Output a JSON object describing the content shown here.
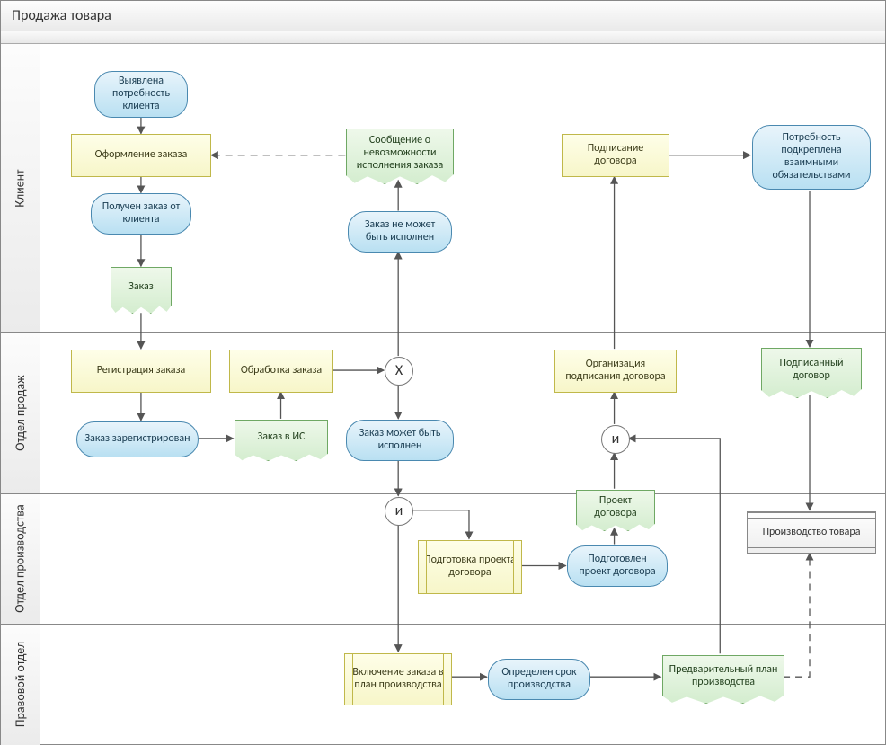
{
  "title": "Продажа товара",
  "lanes": {
    "l1": "Клиент",
    "l2": "Отдел продаж",
    "l3": "Отдел производства",
    "l4": "Правовой отдел"
  },
  "nodes": {
    "event_need": "Выявлена потребность клиента",
    "act_order": "Оформление заказа",
    "event_got_order": "Получен заказ от клиента",
    "doc_order": "Заказ",
    "doc_msg_impossible": "Сообщение о невозможности исполнения заказа",
    "event_cant_exec": "Заказ не может быть исполнен",
    "act_sign_contract": "Подписание договора",
    "event_need_confirmed": "Потребность подкреплена взаимными обязательствами",
    "act_register": "Регистрация заказа",
    "act_process": "Обработка заказа",
    "gw_x": "X",
    "event_registered": "Заказ зарегистрирован",
    "doc_order_is": "Заказ в ИС",
    "event_can_exec": "Заказ может быть исполнен",
    "act_org_sign": "Организация подписания договора",
    "doc_signed": "Подписанный договор",
    "gw_and1": "и",
    "gw_and2": "и",
    "doc_draft": "Проект договора",
    "act_prep_draft": "Подготовка проекта договора",
    "event_draft_ready": "Подготовлен проект договора",
    "proc_production": "Производство товара",
    "act_include_plan": "Включение заказа в план производства",
    "event_term": "Определен срок производства",
    "doc_pre_plan": "Предварительный план производства"
  }
}
